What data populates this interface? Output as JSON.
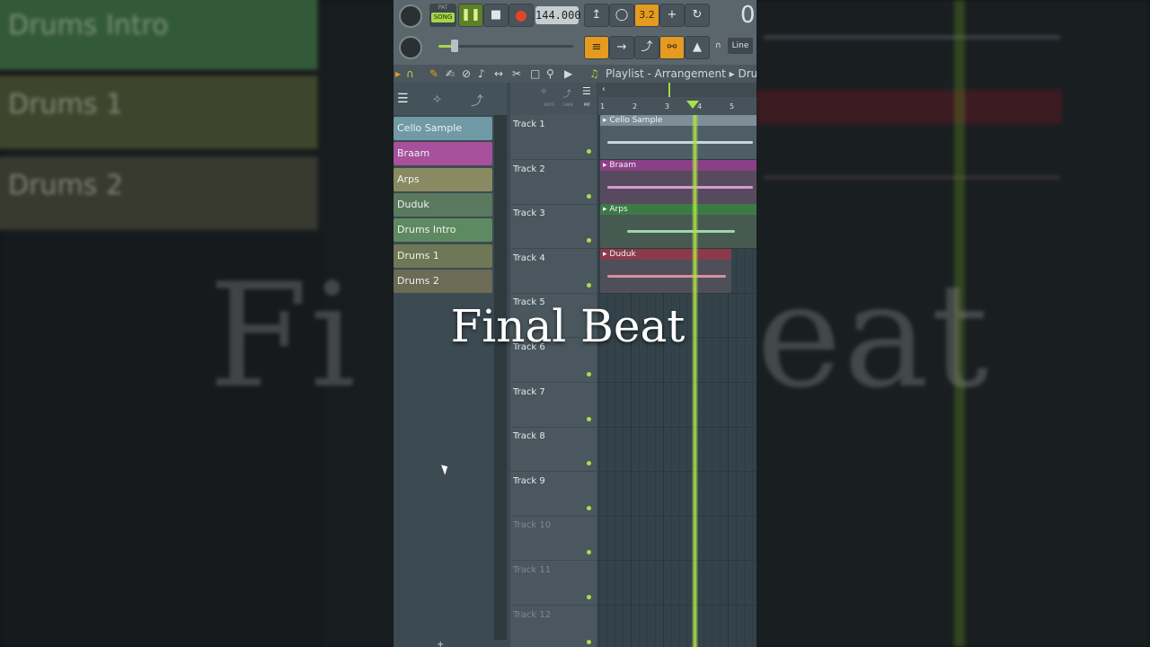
{
  "overlay_title": "Final Beat",
  "background_title_fragments": [
    "Fi",
    "eat"
  ],
  "toolbar": {
    "pat_label": "PAT",
    "song_label": "SONG",
    "tempo": "144.000",
    "counter": "0",
    "snap_label": "Line",
    "play_icon": "pause-icon",
    "stop_icon": "stop-icon",
    "record_icon": "record-icon",
    "highlight_value": "3.2"
  },
  "path": {
    "text": "Playlist - Arrangement ▸ Drums"
  },
  "picker": {
    "mode_labels": [
      "MUTE",
      "CHAN",
      "PAT"
    ],
    "items": [
      {
        "label": "Cello Sample",
        "color": "#6f9aa6"
      },
      {
        "label": "Braam",
        "color": "#a7509c"
      },
      {
        "label": "Arps",
        "color": "#8a8a62"
      },
      {
        "label": "Duduk",
        "color": "#597a5e"
      },
      {
        "label": "Drums Intro",
        "color": "#5e8a61"
      },
      {
        "label": "Drums 1",
        "color": "#6f7756"
      },
      {
        "label": "Drums 2",
        "color": "#6b6b56"
      }
    ]
  },
  "tracks": [
    {
      "label": "Track 1",
      "faded": false
    },
    {
      "label": "Track 2",
      "faded": false
    },
    {
      "label": "Track 3",
      "faded": false
    },
    {
      "label": "Track 4",
      "faded": false
    },
    {
      "label": "Track 5",
      "faded": false
    },
    {
      "label": "Track 6",
      "faded": false
    },
    {
      "label": "Track 7",
      "faded": false
    },
    {
      "label": "Track 8",
      "faded": false
    },
    {
      "label": "Track 9",
      "faded": false
    },
    {
      "label": "Track 10",
      "faded": true
    },
    {
      "label": "Track 11",
      "faded": true
    },
    {
      "label": "Track 12",
      "faded": true
    }
  ],
  "ruler": [
    "1",
    "2",
    "3",
    "4",
    "5"
  ],
  "clips": [
    {
      "label": "Cello Sample",
      "head_color": "#7d8e97",
      "body_color": "#4e5e66",
      "wave_color": "#c9d6dc"
    },
    {
      "label": "Braam",
      "head_color": "#8a3f86",
      "body_color": "#574a5f",
      "wave_color": "#d59ad2"
    },
    {
      "label": "Arps",
      "head_color": "#3c7a45",
      "body_color": "#465a52",
      "wave_color": "#9fd8a8"
    },
    {
      "label": "Duduk",
      "head_color": "#8a3a4a",
      "body_color": "#4e4f58",
      "wave_color": "#d88fa0"
    }
  ],
  "background_clips": [
    {
      "label": "Drums Intro",
      "color": "#3f6e45"
    },
    {
      "label": "Drums 1",
      "color": "#4e5536"
    },
    {
      "label": "Drums 2",
      "color": "#45473a"
    }
  ]
}
